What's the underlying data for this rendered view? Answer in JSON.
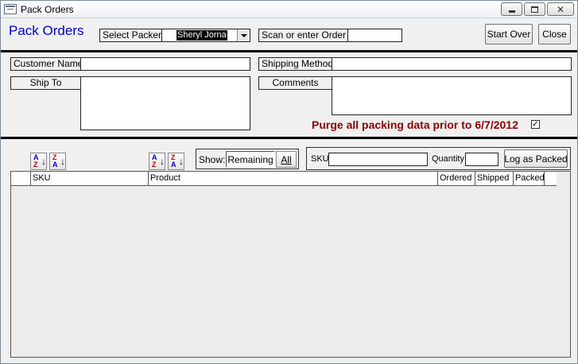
{
  "window": {
    "title": "Pack Orders"
  },
  "header": {
    "title": "Pack Orders",
    "select_packer_label": "Select Packer",
    "packer_value": "Sheryl Jorna",
    "scan_label": "Scan or enter Order #",
    "order_value": "",
    "start_over_label": "Start Over",
    "close_label": "Close"
  },
  "order": {
    "customer_name_label": "Customer Name",
    "customer_name_value": "",
    "shipping_method_label": "Shipping Method",
    "shipping_method_value": "",
    "ship_to_label": "Ship To",
    "ship_to_value": "",
    "comments_label": "Comments",
    "comments_value": "",
    "purge_text": "Purge all packing data prior to 6/7/2012",
    "purge_checked_glyph": "✓"
  },
  "toolbar": {
    "sort_asc_top": "A",
    "sort_asc_bottom": "Z",
    "sort_desc_top": "Z",
    "sort_desc_bottom": "A",
    "show_label": "Show:",
    "remaining_label": "Remaining",
    "all_label": "All",
    "sku_label": "SKU",
    "sku_value": "",
    "quantity_label": "Quantity",
    "quantity_value": "",
    "log_button_label": "Log as Packed"
  },
  "grid": {
    "columns": [
      "SKU",
      "Product",
      "Ordered",
      "Shipped",
      "Packed"
    ],
    "rows": []
  },
  "colors": {
    "title_blue": "#0000cc",
    "purge_red": "#8b0000"
  }
}
